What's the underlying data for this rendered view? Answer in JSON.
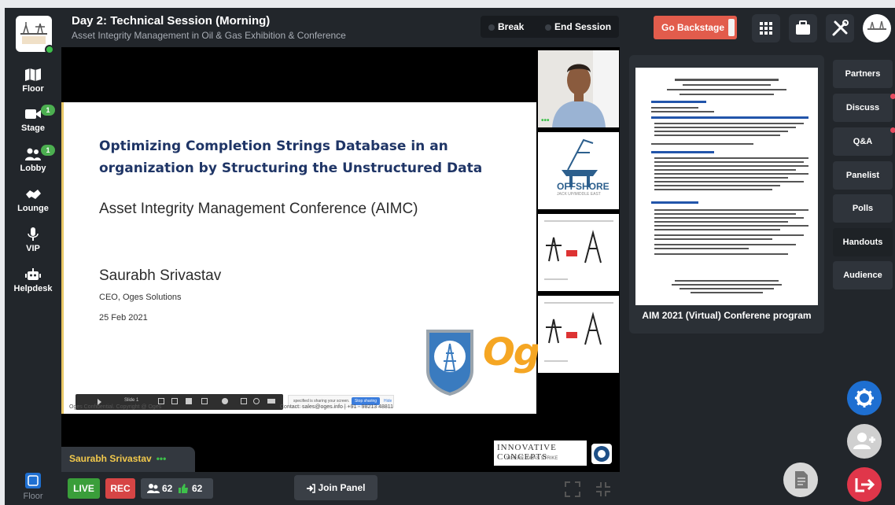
{
  "header": {
    "title": "Day 2: Technical Session (Morning)",
    "subtitle": "Asset Integrity Management in Oil & Gas Exhibition & Conference",
    "break_label": "Break",
    "end_session_label": "End Session",
    "go_backstage_label": "Go Backstage"
  },
  "sidebar": {
    "items": [
      {
        "label": "Floor",
        "icon": "map-icon"
      },
      {
        "label": "Stage",
        "icon": "video-camera-icon",
        "badge": "1"
      },
      {
        "label": "Lobby",
        "icon": "people-icon",
        "badge": "1"
      },
      {
        "label": "Lounge",
        "icon": "handshake-icon"
      },
      {
        "label": "VIP",
        "icon": "microphone-icon"
      },
      {
        "label": "Helpdesk",
        "icon": "robot-icon"
      }
    ],
    "footer_label": "Floor"
  },
  "slide": {
    "title": "Optimizing Completion Strings Database in an organization by Structuring the Unstructured Data",
    "conference": "Asset Integrity Management Conference (AIMC)",
    "presenter": "Saurabh Srivastav",
    "role": "CEO, Oges Solutions",
    "date": "25 Feb 2021",
    "footer": "Oges Confidential. Copyright @ Oges",
    "contact": "Contact: sales@oges.info | +91 - 98213 48811",
    "logo_text": "Og",
    "share_text": "specified is sharing your screen.",
    "stop_sharing": "Stop sharing",
    "hide": "Hide",
    "toolbar_slide": "Slide 1"
  },
  "thumbnails": [
    {
      "kind": "webcam"
    },
    {
      "kind": "logo",
      "text_main": "OFFSHORE",
      "text_sub": "JACK UP/MIDDLE EAST"
    },
    {
      "kind": "graphic"
    },
    {
      "kind": "graphic"
    },
    {
      "kind": "blank"
    }
  ],
  "sponsor": {
    "name": "INNOVATIVE CONCEPTS",
    "tagline": "WHERE IDEAS STRIKE"
  },
  "presenter_label": "Saurabh Srivastav",
  "bottom": {
    "live": "LIVE",
    "rec": "REC",
    "attendees": "62",
    "likes": "62",
    "join_panel": "Join Panel"
  },
  "handout": {
    "caption": "AIM 2021 (Virtual) Conferene program"
  },
  "right_tabs": [
    {
      "label": "Partners",
      "notify": false
    },
    {
      "label": "Discuss",
      "notify": true
    },
    {
      "label": "Q&A",
      "notify": true
    },
    {
      "label": "Panelist",
      "notify": false
    },
    {
      "label": "Polls",
      "notify": false
    },
    {
      "label": "Handouts",
      "notify": false,
      "active": true
    },
    {
      "label": "Audience",
      "notify": false
    }
  ],
  "colors": {
    "accent_blue": "#1e6fd1",
    "leave_red": "#e0364a",
    "backstage": "#e25c4c",
    "live_green": "#3a9e3a",
    "rec_red": "#d64545"
  }
}
